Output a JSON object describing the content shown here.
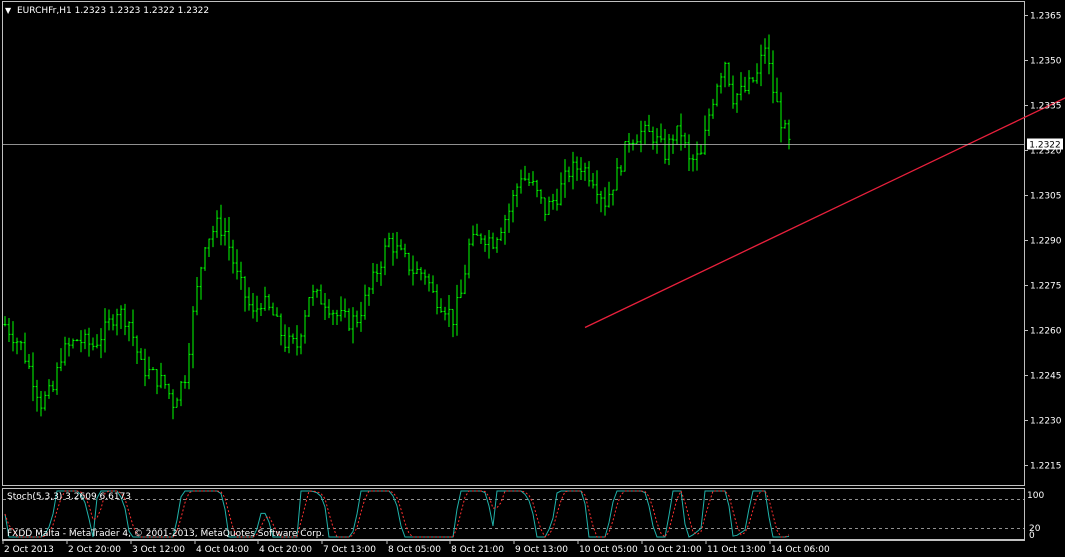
{
  "header": {
    "menu_glyph": "▼",
    "symbol_line": "EURCHFr,H1  1.2323 1.2323 1.2322 1.2322"
  },
  "indicator": {
    "title": "Stoch(5,3,3) 3.2609 6.6173",
    "level_high": "80",
    "level_low": "20",
    "scale_top": "100",
    "scale_bottom": "0"
  },
  "footer": {
    "copyright": "FXDD Malta - MetaTrader 4, © 2001-2013, MetaQuotes Software Corp."
  },
  "colors": {
    "background": "#000000",
    "bull_bar": "#00ff00",
    "bear_bar": "#00ff00",
    "trendline": "#e8203c",
    "bid_line": "#c0c0c0",
    "stoch_main": "#20b2aa",
    "stoch_signal": "#ff3030",
    "level_line": "#c0c0c0"
  },
  "chart_data": {
    "type": "ohlc",
    "symbol": "EURCHFr",
    "timeframe": "H1",
    "last_price": "1.2322",
    "y_ticks": [
      "1.2365",
      "1.2350",
      "1.2335",
      "1.2320",
      "1.2305",
      "1.2290",
      "1.2275",
      "1.2260",
      "1.2245",
      "1.2230",
      "1.2215"
    ],
    "ylim": [
      1.22085,
      1.23695
    ],
    "x_ticks": [
      "2 Oct 2013",
      "2 Oct 20:00",
      "3 Oct 12:00",
      "4 Oct 04:00",
      "4 Oct 20:00",
      "7 Oct 13:00",
      "8 Oct 05:00",
      "8 Oct 21:00",
      "9 Oct 13:00",
      "10 Oct 05:00",
      "10 Oct 21:00",
      "11 Oct 13:00",
      "14 Oct 06:00"
    ],
    "bars_count": 202,
    "close_path": [
      [
        0,
        1.2262
      ],
      [
        4,
        1.2255
      ],
      [
        7,
        1.2244
      ],
      [
        9,
        1.2236
      ],
      [
        12,
        1.224
      ],
      [
        14,
        1.2252
      ],
      [
        18,
        1.2257
      ],
      [
        22,
        1.2255
      ],
      [
        25,
        1.226
      ],
      [
        28,
        1.2267
      ],
      [
        31,
        1.2263
      ],
      [
        34,
        1.2248
      ],
      [
        37,
        1.2245
      ],
      [
        40,
        1.2242
      ],
      [
        42,
        1.2236
      ],
      [
        45,
        1.2245
      ],
      [
        47,
        1.2265
      ],
      [
        50,
        1.229
      ],
      [
        53,
        1.2295
      ],
      [
        55,
        1.2293
      ],
      [
        58,
        1.2278
      ],
      [
        62,
        1.2265
      ],
      [
        64,
        1.227
      ],
      [
        67,
        1.2265
      ],
      [
        70,
        1.2256
      ],
      [
        73,
        1.2255
      ],
      [
        76,
        1.2272
      ],
      [
        80,
        1.227
      ],
      [
        83,
        1.2265
      ],
      [
        86,
        1.2263
      ],
      [
        88,
        1.2264
      ],
      [
        90,
        1.227
      ],
      [
        93,
        1.228
      ],
      [
        96,
        1.229
      ],
      [
        99,
        1.2285
      ],
      [
        102,
        1.228
      ],
      [
        105,
        1.2279
      ],
      [
        107,
        1.2272
      ],
      [
        110,
        1.2268
      ],
      [
        112,
        1.2264
      ],
      [
        114,
        1.2272
      ],
      [
        116,
        1.2288
      ],
      [
        119,
        1.2292
      ],
      [
        122,
        1.229
      ],
      [
        126,
        1.23
      ],
      [
        129,
        1.2312
      ],
      [
        132,
        1.2308
      ],
      [
        135,
        1.23
      ],
      [
        138,
        1.2305
      ],
      [
        141,
        1.2313
      ],
      [
        144,
        1.2315
      ],
      [
        147,
        1.2311
      ],
      [
        150,
        1.2303
      ],
      [
        153,
        1.2312
      ],
      [
        156,
        1.2324
      ],
      [
        159,
        1.2326
      ],
      [
        162,
        1.2325
      ],
      [
        165,
        1.2319
      ],
      [
        167,
        1.2325
      ],
      [
        169,
        1.2326
      ],
      [
        171,
        1.2316
      ],
      [
        174,
        1.2318
      ],
      [
        176,
        1.2332
      ],
      [
        178,
        1.2343
      ],
      [
        180,
        1.235
      ],
      [
        182,
        1.2338
      ],
      [
        185,
        1.234
      ],
      [
        188,
        1.2345
      ],
      [
        190,
        1.2355
      ],
      [
        192,
        1.234
      ],
      [
        194,
        1.233
      ],
      [
        196,
        1.2322
      ]
    ],
    "trendline": {
      "from": {
        "bar": 145,
        "price": 1.2261
      },
      "to": {
        "bar": 316,
        "price": 1.237
      }
    },
    "stochastic": {
      "main_last": 3.2609,
      "signal_last": 6.6173,
      "levels": [
        20,
        80
      ],
      "range": [
        0,
        100
      ]
    }
  }
}
